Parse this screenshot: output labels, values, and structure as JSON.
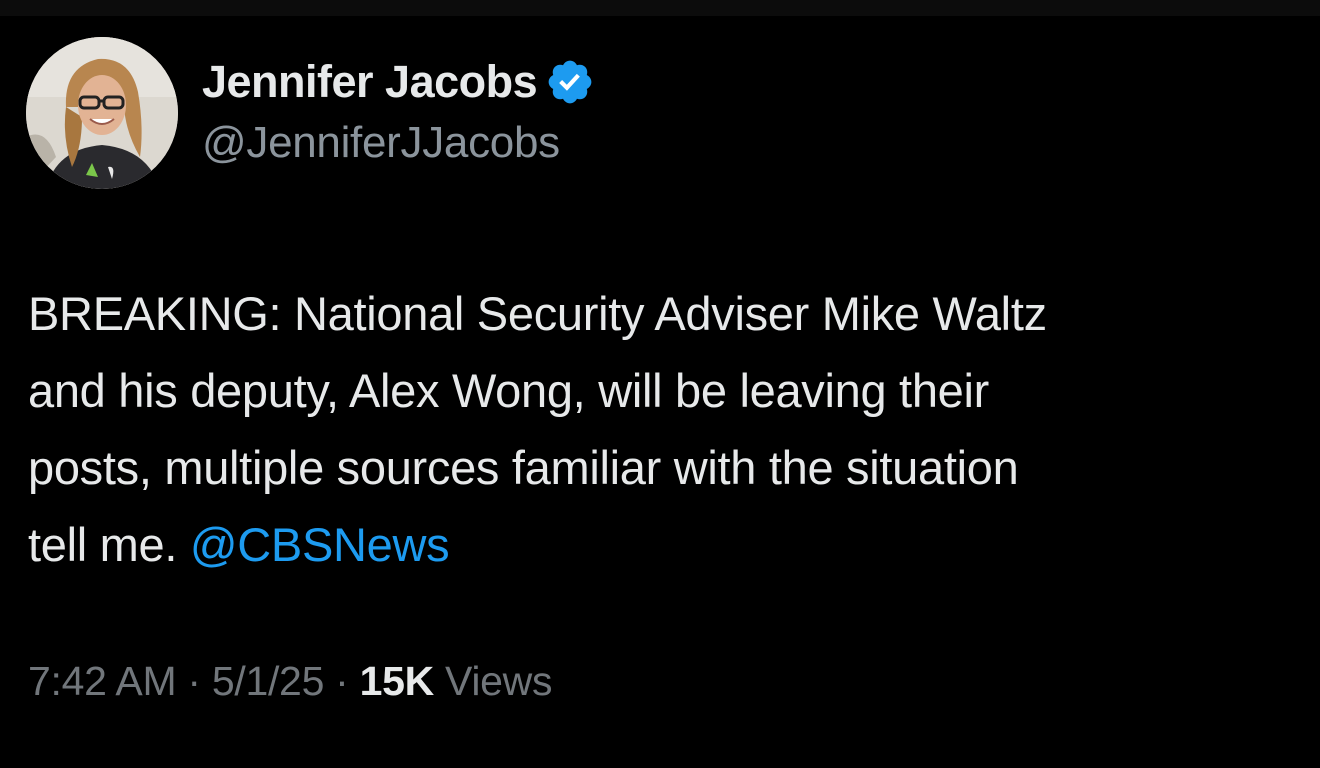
{
  "author": {
    "display_name": "Jennifer Jacobs",
    "handle": "@JenniferJJacobs",
    "verified": true,
    "verified_badge_color": "#1d9bf0"
  },
  "tweet": {
    "lines": [
      "BREAKING: National Security Adviser Mike Waltz",
      "and his deputy, Alex Wong, will be leaving their",
      "posts, multiple sources familiar with the situation",
      "tell me. "
    ],
    "mention": "@CBSNews"
  },
  "meta": {
    "time": "7:42 AM",
    "separator": "·",
    "date": "5/1/25",
    "views_count": "15K",
    "views_label": "Views"
  },
  "colors": {
    "background": "#000000",
    "text": "#e7e9ea",
    "secondary_text": "#71767b",
    "link": "#1d9bf0"
  }
}
